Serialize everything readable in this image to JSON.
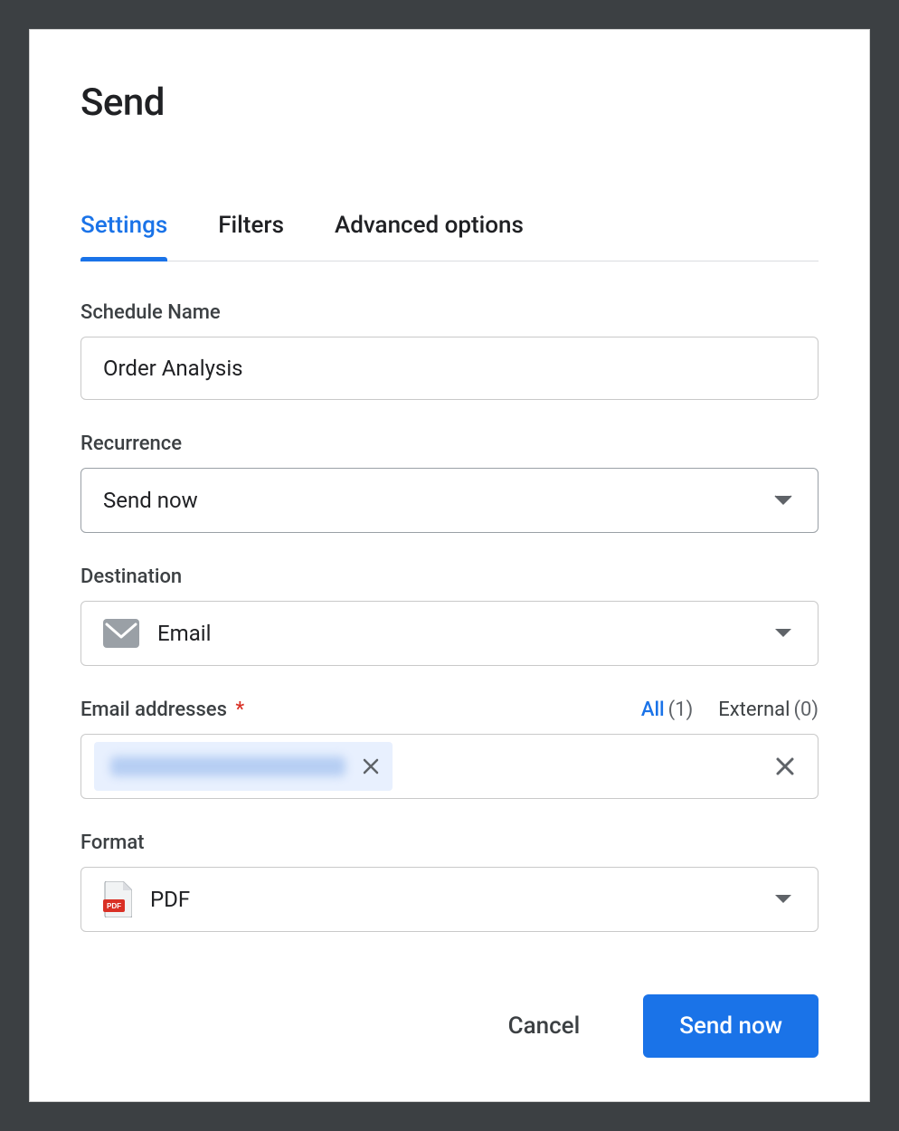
{
  "dialog": {
    "title": "Send"
  },
  "tabs": {
    "settings": "Settings",
    "filters": "Filters",
    "advanced": "Advanced options"
  },
  "form": {
    "schedule_name": {
      "label": "Schedule Name",
      "value": "Order Analysis"
    },
    "recurrence": {
      "label": "Recurrence",
      "value": "Send now"
    },
    "destination": {
      "label": "Destination",
      "value": "Email"
    },
    "email": {
      "label": "Email addresses",
      "required_marker": "*",
      "counts": {
        "all_label": "All",
        "all_value": "(1)",
        "external_label": "External",
        "external_value": "(0)"
      },
      "chip_value": "(redacted email)"
    },
    "format": {
      "label": "Format",
      "value": "PDF"
    }
  },
  "footer": {
    "cancel": "Cancel",
    "submit": "Send now"
  }
}
